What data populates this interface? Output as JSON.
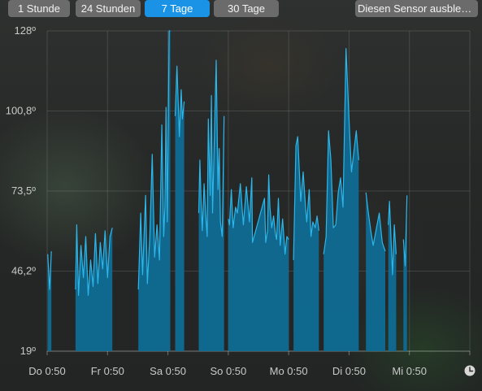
{
  "toolbar": {
    "tabs": [
      {
        "label": "1 Stunde",
        "active": false
      },
      {
        "label": "24 Stunden",
        "active": false
      },
      {
        "label": "7 Tage",
        "active": true
      },
      {
        "label": "30 Tage",
        "active": false
      }
    ],
    "hide_sensor_label": "Diesen Sensor ausblen…"
  },
  "colors": {
    "area_fill": "#0f6b94",
    "line": "#2cb6ea",
    "accent": "#1a93e6",
    "tab_bg": "#6b6b6b"
  },
  "icons": {
    "time_icon": "clock-icon"
  },
  "chart_data": {
    "type": "area",
    "title": "",
    "xlabel": "",
    "ylabel": "",
    "ylim": [
      19,
      128
    ],
    "y_ticks": [
      "128º",
      "100,8º",
      "73,5º",
      "46,2º",
      "19º"
    ],
    "x_ticks": [
      "Do 0:50",
      "Fr 0:50",
      "Sa 0:50",
      "So 0:50",
      "Mo 0:50",
      "Di 0:50",
      "Mi 0:50"
    ],
    "x_unit": "days since Do 0:50",
    "grid": true,
    "x": [
      0.0,
      0.01,
      0.04,
      0.07,
      0.08,
      0.46,
      0.47,
      0.49,
      0.52,
      0.56,
      0.6,
      0.64,
      0.68,
      0.72,
      0.76,
      0.8,
      0.84,
      0.88,
      0.92,
      0.96,
      1.0,
      1.04,
      1.08,
      1.01,
      1.5,
      1.51,
      1.55,
      1.58,
      1.63,
      1.66,
      1.7,
      1.74,
      1.78,
      1.82,
      1.86,
      1.9,
      1.93,
      1.95,
      1.97,
      1.99,
      2.02,
      2.04,
      2.07,
      2.1,
      2.12,
      2.15,
      2.19,
      2.22,
      2.24,
      2.27,
      2.3,
      2.5,
      2.51,
      2.53,
      2.55,
      2.57,
      2.6,
      2.63,
      2.65,
      2.67,
      2.7,
      2.72,
      2.74,
      2.8,
      2.83,
      2.85,
      2.87,
      2.9,
      2.93,
      2.96,
      2.98,
      3.0,
      3.02,
      3.05,
      3.08,
      3.12,
      3.15,
      3.2,
      3.25,
      3.3,
      3.35,
      3.39,
      3.4,
      3.6,
      3.62,
      3.65,
      3.67,
      3.69,
      3.72,
      3.75,
      3.78,
      3.8,
      3.83,
      3.86,
      3.9,
      3.94,
      3.97,
      4.0,
      4.03,
      4.06,
      4.08,
      4.12,
      4.15,
      4.2,
      4.24,
      4.28,
      4.3,
      4.34,
      4.37,
      4.4,
      4.44,
      4.47,
      4.5,
      4.52,
      4.55,
      4.58,
      4.62,
      4.66,
      4.7,
      4.74,
      4.78,
      4.82,
      4.86,
      4.9,
      4.95,
      5.0,
      5.04,
      5.08,
      5.12,
      5.16,
      5.2,
      5.24,
      5.28,
      5.32,
      5.36,
      5.4,
      5.5,
      5.55,
      5.6,
      5.62,
      5.65,
      5.67,
      5.7,
      5.72,
      5.75,
      5.78,
      5.8,
      5.83,
      5.86,
      5.9,
      5.93,
      5.96,
      6.0,
      6.02,
      6.05,
      6.07,
      6.1,
      6.13,
      6.16,
      6.2,
      6.24,
      6.28,
      6.32,
      6.34,
      6.36,
      6.38,
      6.4,
      6.45,
      6.49,
      6.51,
      6.53,
      6.55,
      6.58,
      6.61,
      6.63,
      6.65,
      6.67,
      6.7,
      6.73,
      6.75,
      6.78,
      6.8,
      6.83,
      6.86,
      6.88,
      6.9,
      6.92,
      6.94,
      6.96,
      6.98,
      7.0
    ],
    "series": [
      {
        "values": [
          null,
          52,
          40,
          53,
          null,
          null,
          40,
          62,
          38,
          55,
          44,
          58,
          38,
          50,
          41,
          59,
          42,
          56,
          47,
          60,
          44,
          58,
          61,
          null,
          null,
          40,
          66,
          45,
          72,
          42,
          58,
          86,
          51,
          62,
          50,
          96,
          58,
          68,
          102,
          63,
          128,
          128,
          null,
          null,
          99,
          116,
          92,
          108,
          98,
          104,
          null,
          null,
          66,
          84,
          70,
          60,
          76,
          64,
          58,
          98,
          72,
          106,
          66,
          118,
          74,
          88,
          63,
          58,
          99,
          null,
          null,
          64,
          62,
          74,
          61,
          68,
          66,
          76,
          62,
          75,
          63,
          78,
          56,
          71,
          56,
          60,
          79,
          68,
          61,
          65,
          59,
          57,
          71,
          55,
          64,
          52,
          58,
          57,
          null,
          null,
          50,
          89,
          92,
          70,
          80,
          68,
          63,
          74,
          58,
          63,
          61,
          65,
          60,
          null,
          null,
          52,
          58,
          94,
          84,
          61,
          62,
          73,
          78,
          68,
          122,
          98,
          80,
          87,
          94,
          84,
          null,
          null,
          73,
          66,
          60,
          55,
          66,
          56,
          53,
          null,
          62,
          70,
          55,
          45,
          62,
          52,
          null,
          null,
          null,
          57,
          48,
          72
        ]
      }
    ]
  }
}
